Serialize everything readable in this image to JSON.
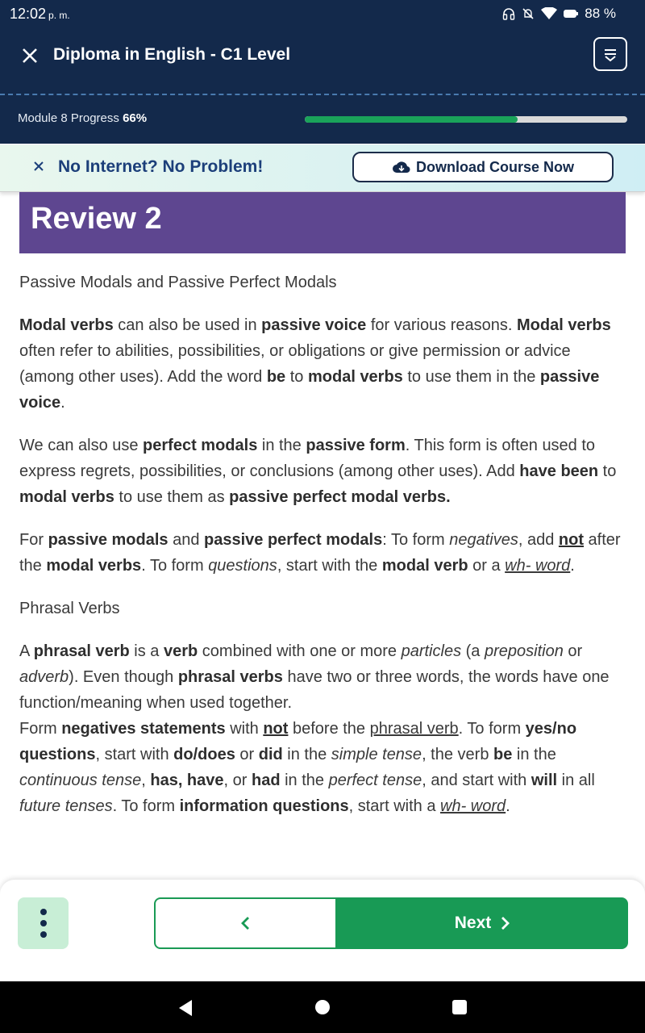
{
  "status_bar": {
    "time": "12:02",
    "ampm": "p. m.",
    "battery": "88 %",
    "icons": [
      "headset-icon",
      "mute-icon",
      "wifi-icon",
      "battery-icon"
    ]
  },
  "header": {
    "title": "Diploma in English - C1 Level",
    "progress_label": "Module 8 Progress",
    "progress_value": "66%",
    "progress_fraction": 0.66
  },
  "banner": {
    "text": "No Internet? No Problem!",
    "button_label": "Download Course Now"
  },
  "lesson": {
    "heading": "Review 2",
    "subheading1": "Passive Modals and Passive Perfect Modals",
    "p1": [
      {
        "t": "Modal verbs",
        "b": true
      },
      {
        "t": " can also be used in "
      },
      {
        "t": "passive voice",
        "b": true
      },
      {
        "t": " for various reasons. "
      },
      {
        "t": "Modal verbs",
        "b": true
      },
      {
        "t": " often refer to abilities, possibilities, or obligations or give permission or advice (among other uses). Add the word "
      },
      {
        "t": "be",
        "b": true
      },
      {
        "t": " to "
      },
      {
        "t": "modal verbs",
        "b": true
      },
      {
        "t": " to use them in the "
      },
      {
        "t": "passive voice",
        "b": true
      },
      {
        "t": "."
      }
    ],
    "p2": [
      {
        "t": "We can also use "
      },
      {
        "t": "perfect modals",
        "b": true
      },
      {
        "t": " in the "
      },
      {
        "t": "passive form",
        "b": true
      },
      {
        "t": ". This form is often used to express regrets, possibilities, or conclusions (among other uses). Add "
      },
      {
        "t": "have been",
        "b": true
      },
      {
        "t": " to "
      },
      {
        "t": "modal verbs",
        "b": true
      },
      {
        "t": " to use them as "
      },
      {
        "t": "passive perfect modal verbs.",
        "b": true
      }
    ],
    "p3": [
      {
        "t": "For "
      },
      {
        "t": "passive modals",
        "b": true
      },
      {
        "t": " and "
      },
      {
        "t": "passive perfect modals",
        "b": true
      },
      {
        "t": ": To form "
      },
      {
        "t": "negatives",
        "i": true
      },
      {
        "t": ", add "
      },
      {
        "t": "not",
        "b": true,
        "u": true
      },
      {
        "t": " after the "
      },
      {
        "t": "modal verbs",
        "b": true
      },
      {
        "t": ". To form "
      },
      {
        "t": "questions",
        "i": true
      },
      {
        "t": ", start with the "
      },
      {
        "t": "modal verb",
        "b": true
      },
      {
        "t": " or a "
      },
      {
        "t": "wh- word",
        "i": true,
        "u": true
      },
      {
        "t": "."
      }
    ],
    "subheading2": "Phrasal Verbs",
    "p4": [
      {
        "t": "A "
      },
      {
        "t": "phrasal verb",
        "b": true
      },
      {
        "t": " is a "
      },
      {
        "t": "verb",
        "b": true
      },
      {
        "t": " combined with one or more "
      },
      {
        "t": "particles",
        "i": true
      },
      {
        "t": " (a "
      },
      {
        "t": "preposition",
        "i": true
      },
      {
        "t": " or "
      },
      {
        "t": "adverb",
        "i": true
      },
      {
        "t": "). Even though "
      },
      {
        "t": "phrasal verbs",
        "b": true
      },
      {
        "t": " have two or three words, the words have one function/meaning when used together."
      },
      {
        "br": true
      },
      {
        "t": "Form "
      },
      {
        "t": "negatives statements",
        "b": true
      },
      {
        "t": " with "
      },
      {
        "t": "not",
        "b": true,
        "u": true
      },
      {
        "t": " before the "
      },
      {
        "t": "phrasal verb",
        "u": true
      },
      {
        "t": ". To form "
      },
      {
        "t": "yes/no questions",
        "b": true
      },
      {
        "t": ", start with "
      },
      {
        "t": "do/does",
        "b": true
      },
      {
        "t": " or "
      },
      {
        "t": "did",
        "b": true
      },
      {
        "t": " in the "
      },
      {
        "t": "simple tense",
        "i": true
      },
      {
        "t": ", the verb "
      },
      {
        "t": "be",
        "b": true
      },
      {
        "t": " in the "
      },
      {
        "t": "continuous tense",
        "i": true
      },
      {
        "t": ", "
      },
      {
        "t": "has, have",
        "b": true
      },
      {
        "t": ", or "
      },
      {
        "t": "had",
        "b": true
      },
      {
        "t": " in the "
      },
      {
        "t": "perfect tense",
        "i": true
      },
      {
        "t": ", and start with "
      },
      {
        "t": "will",
        "b": true
      },
      {
        "t": " in all "
      },
      {
        "t": "future tenses",
        "i": true
      },
      {
        "t": ". To form "
      },
      {
        "t": "information questions",
        "b": true
      },
      {
        "t": ", start with a "
      },
      {
        "t": "wh- word",
        "i": true,
        "u": true
      },
      {
        "t": "."
      }
    ]
  },
  "footer": {
    "next_label": "Next"
  },
  "colors": {
    "header_bg": "#13294b",
    "review_bg": "#5e4690",
    "accent_green": "#189a55",
    "banner_text": "#1c3f7a"
  }
}
